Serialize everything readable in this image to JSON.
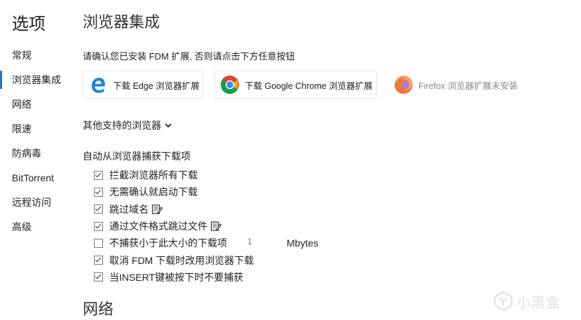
{
  "sidebar": {
    "title": "选项",
    "items": [
      {
        "label": "常规"
      },
      {
        "label": "浏览器集成"
      },
      {
        "label": "网络"
      },
      {
        "label": "限速"
      },
      {
        "label": "防病毒"
      },
      {
        "label": "BitTorrent"
      },
      {
        "label": "远程访问"
      },
      {
        "label": "高级"
      }
    ],
    "active_index": 1
  },
  "main": {
    "section_title": "浏览器集成",
    "notice": "请确认您已安装 FDM 扩展, 否则请点击下方任意按钮",
    "browsers": [
      {
        "label": "下载 Edge 浏览器扩展",
        "icon": "edge-icon"
      },
      {
        "label": "下载 Google Chrome 浏览器扩展",
        "icon": "chrome-icon"
      },
      {
        "label": "Firefox 浏览器扩展未安装",
        "icon": "firefox-icon"
      }
    ],
    "other_browsers_label": "其他支持的浏览器",
    "capture_title": "自动从浏览器捕获下载项",
    "options": [
      {
        "label": "拦截浏览器所有下载",
        "checked": true
      },
      {
        "label": "无需确认就启动下载",
        "checked": true
      },
      {
        "label": "跳过域名",
        "checked": true,
        "editable": true
      },
      {
        "label": "通过文件格式跳过文件",
        "checked": true,
        "editable": true
      },
      {
        "label": "不捕获小于此大小的下载项",
        "checked": false,
        "size_value": "1",
        "size_unit": "Mbytes"
      },
      {
        "label": "取消 FDM 下载时改用浏览器下载",
        "checked": true
      },
      {
        "label": "当INSERT键被按下时不要捕获",
        "checked": true
      }
    ],
    "next_section_title": "网络"
  },
  "watermark": {
    "text": "小黑盒"
  },
  "colors": {
    "accent": "#2a6fd6",
    "edge_blue": "#1e88d6",
    "disabled_text": "#8a8a8a"
  }
}
